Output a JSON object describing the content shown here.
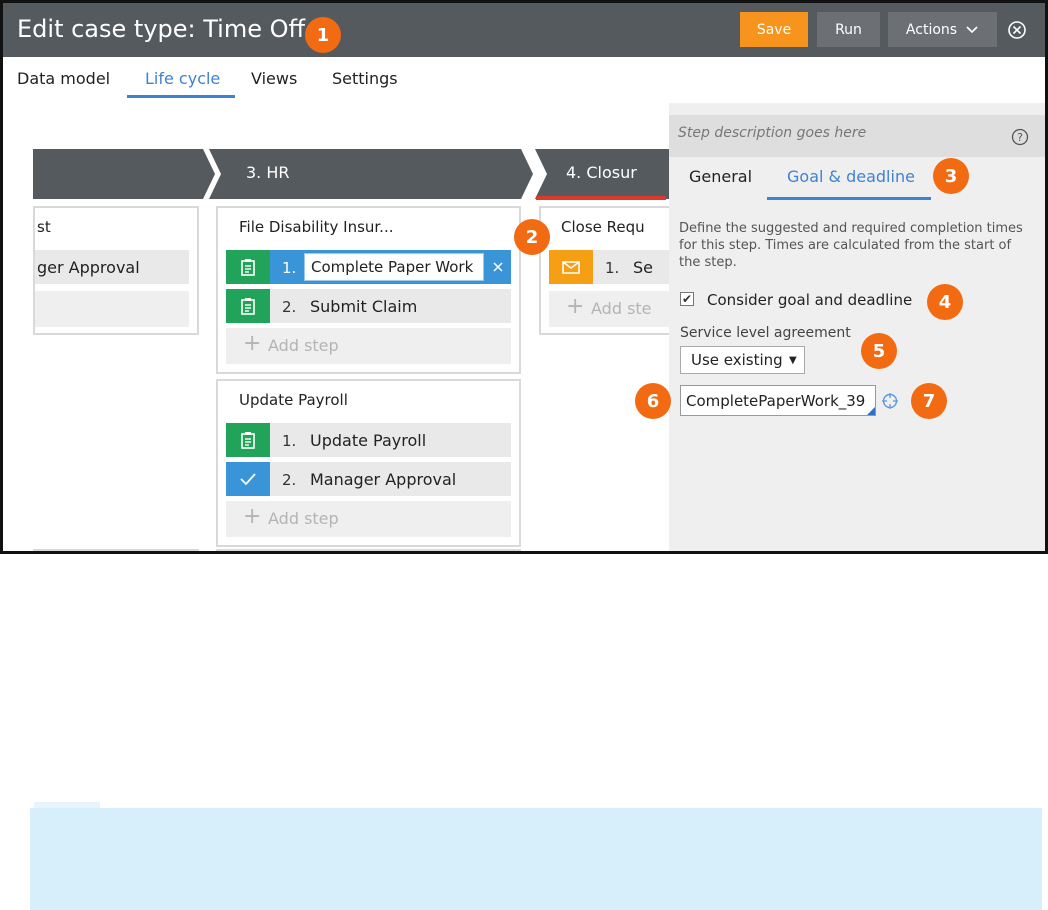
{
  "header": {
    "title": "Edit case type: Time Off",
    "save_label": "Save",
    "run_label": "Run",
    "actions_label": "Actions"
  },
  "tabs": [
    {
      "label": "Data model"
    },
    {
      "label": "Life cycle",
      "active": true
    },
    {
      "label": "Views"
    },
    {
      "label": "Settings"
    }
  ],
  "stages": [
    {
      "label": "3.  HR"
    },
    {
      "label": "4.  Closur"
    }
  ],
  "processes": {
    "left_partial": {
      "title": "st",
      "step_text": "ger Approval"
    },
    "file_disability": {
      "title": "File Disability Insur...",
      "steps": [
        {
          "num": "1.",
          "text": "Complete Paper Work",
          "icon": "form-icon"
        },
        {
          "num": "2.",
          "text": "Submit Claim",
          "icon": "form-icon"
        }
      ],
      "add_step": "Add step"
    },
    "update_payroll": {
      "title": "Update Payroll",
      "steps": [
        {
          "num": "1.",
          "text": "Update Payroll",
          "icon": "form-icon"
        },
        {
          "num": "2.",
          "text": "Manager Approval",
          "icon": "check-icon"
        }
      ],
      "add_step": "Add step"
    },
    "close_request": {
      "title": "Close Requ",
      "steps": [
        {
          "num": "1.",
          "text": "Se",
          "icon": "envelope-icon"
        }
      ],
      "add_step": "Add ste"
    }
  },
  "panel": {
    "description_placeholder": "Step description goes here",
    "tabs": [
      {
        "label": "General"
      },
      {
        "label": "Goal & deadline",
        "active": true
      }
    ],
    "define_text": "Define the suggested and required completion times for this step. Times are calculated from the start of the step.",
    "consider_checkbox": {
      "label": "Consider goal and deadline",
      "checked": true
    },
    "sla_label": "Service level agreement",
    "sla_select": "Use existing",
    "sla_value": "CompletePaperWork_39"
  },
  "badges": [
    "1",
    "2",
    "3",
    "4",
    "5",
    "6",
    "7"
  ],
  "colors": {
    "header_bg": "#555a5f",
    "save_orange": "#f7941d",
    "accent_blue": "#3f82d4",
    "badge_orange": "#f26a12",
    "step_green": "#21a35a",
    "step_blue": "#3a95d8",
    "step_orange": "#f5a014",
    "note_bg": "#d7effb"
  }
}
